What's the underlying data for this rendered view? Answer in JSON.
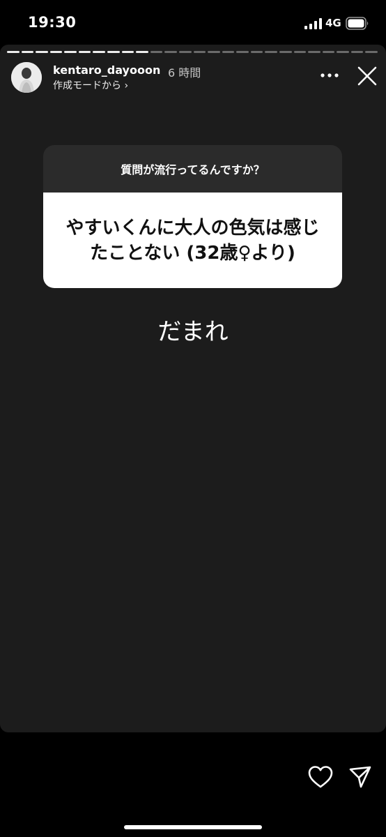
{
  "status_bar": {
    "time": "19:30",
    "network": "4G",
    "icons": [
      "signal-icon",
      "battery-icon"
    ]
  },
  "story": {
    "progress": {
      "segments_total": 26,
      "segments_seen": 10
    },
    "header": {
      "username": "kentaro_dayooon",
      "timestamp": "6 時間",
      "source_link": "作成モードから ›",
      "icons": [
        "avatar",
        "more-icon",
        "close-icon"
      ]
    },
    "question_sticker": {
      "prompt": "質問が流行ってるんですか？",
      "question_line1": "やすいくんに大人の色気は感じ",
      "question_line2": "たことない (32歳♀より)"
    },
    "reply": "だまれ"
  },
  "actions": {
    "icons": [
      "heart-icon",
      "send-icon"
    ]
  },
  "colors": {
    "background": "#000000",
    "story_background": "#1c1c1c",
    "sticker_header": "#2b2b2b",
    "sticker_body": "#ffffff"
  }
}
